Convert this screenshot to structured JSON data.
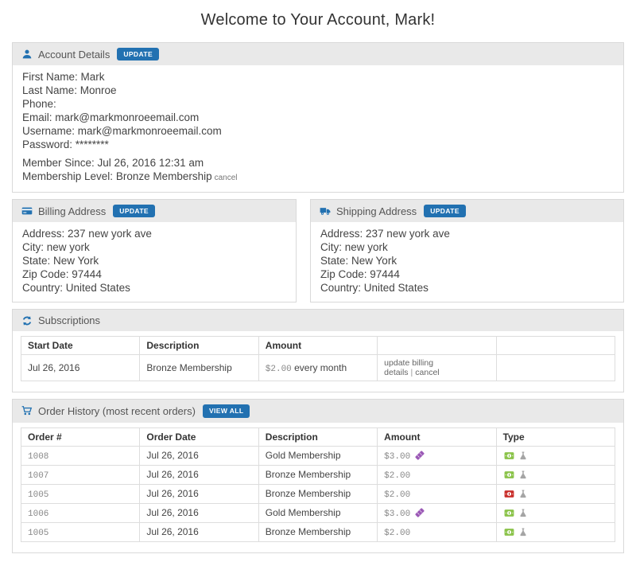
{
  "page": {
    "title": "Welcome to Your Account, Mark!"
  },
  "buttons": {
    "update": "UPDATE",
    "view_all": "VIEW ALL"
  },
  "colors": {
    "accent": "#2271b1",
    "band": "#e9e9e9",
    "live": "#8bc34a",
    "refunded": "#c9302c",
    "coupon": "#9b59b6"
  },
  "account": {
    "title": "Account Details",
    "icon": "user-icon",
    "fields": [
      {
        "label": "First Name:",
        "value": "Mark"
      },
      {
        "label": "Last Name:",
        "value": "Monroe"
      },
      {
        "label": "Phone:",
        "value": ""
      },
      {
        "label": "Email:",
        "value": "mark@markmonroeemail.com"
      },
      {
        "label": "Username:",
        "value": "mark@markmonroeemail.com"
      },
      {
        "label": "Password:",
        "value": "********"
      }
    ],
    "membership": [
      {
        "label": "Member Since:",
        "value": "Jul 26, 2016 12:31 am"
      },
      {
        "label": "Membership Level:",
        "value": "Bronze Membership",
        "action": "cancel"
      }
    ]
  },
  "billing": {
    "title": "Billing Address",
    "icon": "credit-card-icon",
    "fields": [
      {
        "label": "Address:",
        "value": "237 new york ave"
      },
      {
        "label": "City:",
        "value": "new york"
      },
      {
        "label": "State:",
        "value": "New York"
      },
      {
        "label": "Zip Code:",
        "value": "97444"
      },
      {
        "label": "Country:",
        "value": "United States"
      }
    ]
  },
  "shipping": {
    "title": "Shipping Address",
    "icon": "truck-icon",
    "fields": [
      {
        "label": "Address:",
        "value": "237 new york ave"
      },
      {
        "label": "City:",
        "value": "new york"
      },
      {
        "label": "State:",
        "value": "New York"
      },
      {
        "label": "Zip Code:",
        "value": "97444"
      },
      {
        "label": "Country:",
        "value": "United States"
      }
    ]
  },
  "subscriptions": {
    "title": "Subscriptions",
    "icon": "refresh-icon",
    "headers": [
      "Start Date",
      "Description",
      "Amount",
      "",
      ""
    ],
    "rows": [
      {
        "start_date": "Jul 26, 2016",
        "description": "Bronze Membership",
        "amount": "$2.00",
        "amount_note": "every month",
        "actions": [
          "update billing details",
          "cancel"
        ]
      }
    ]
  },
  "orders": {
    "title": "Order History (most recent orders)",
    "icon": "cart-icon",
    "coupon_icon": "ticket-icon",
    "type_icons": [
      "money-bill-icon",
      "flask-icon"
    ],
    "headers": [
      "Order #",
      "Order Date",
      "Description",
      "Amount",
      "Type"
    ],
    "rows": [
      {
        "number": "1008",
        "date": "Jul 26, 2016",
        "description": "Gold Membership",
        "amount": "$3.00",
        "coupon": true,
        "payment": "live"
      },
      {
        "number": "1007",
        "date": "Jul 26, 2016",
        "description": "Bronze Membership",
        "amount": "$2.00",
        "coupon": false,
        "payment": "live"
      },
      {
        "number": "1005",
        "date": "Jul 26, 2016",
        "description": "Bronze Membership",
        "amount": "$2.00",
        "coupon": false,
        "payment": "refunded"
      },
      {
        "number": "1006",
        "date": "Jul 26, 2016",
        "description": "Gold Membership",
        "amount": "$3.00",
        "coupon": true,
        "payment": "live"
      },
      {
        "number": "1005",
        "date": "Jul 26, 2016",
        "description": "Bronze Membership",
        "amount": "$2.00",
        "coupon": false,
        "payment": "live"
      }
    ]
  }
}
